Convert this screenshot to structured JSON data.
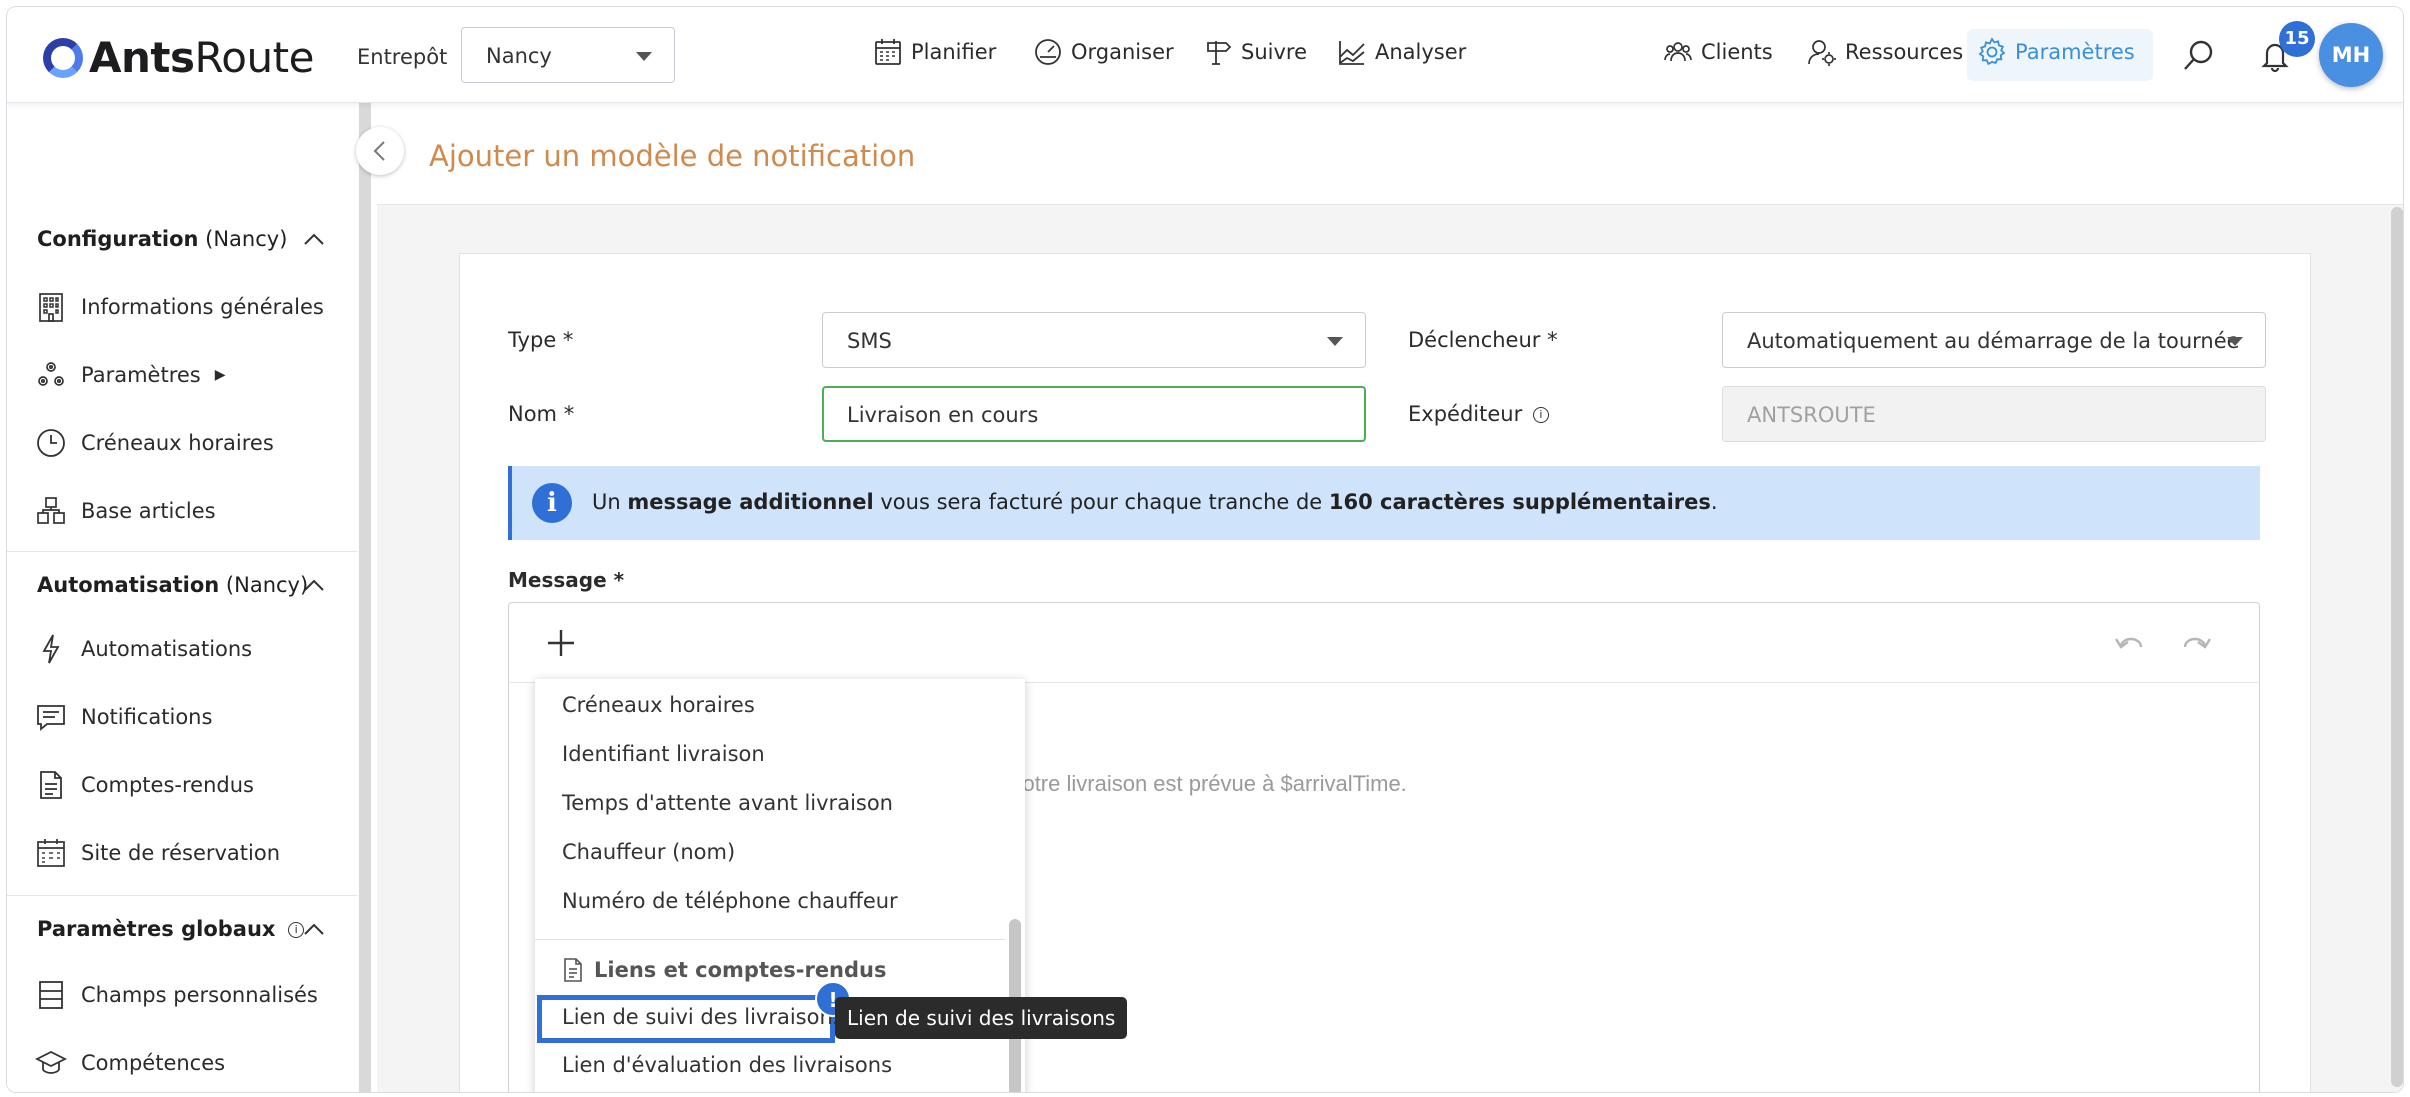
{
  "app": {
    "logo_bold": "Ants",
    "logo_light": "Route"
  },
  "header": {
    "entrepot_label": "Entrepôt",
    "entrepot_value": "Nancy",
    "nav": {
      "planifier": "Planifier",
      "organiser": "Organiser",
      "suivre": "Suivre",
      "analyser": "Analyser",
      "clients": "Clients",
      "ressources": "Ressources",
      "parametres": "Paramètres"
    },
    "notification_count": "15",
    "avatar_initials": "MH",
    "accent_color": "#3b8fd6"
  },
  "sidebar": {
    "sections": [
      {
        "title": "Configuration",
        "suffix": " (Nancy)"
      },
      {
        "title": "Automatisation",
        "suffix": " (Nancy)"
      },
      {
        "title": "Paramètres globaux",
        "suffix": ""
      }
    ],
    "items": {
      "informations_generales": "Informations générales",
      "parametres": "Paramètres",
      "creneaux_horaires": "Créneaux horaires",
      "base_articles": "Base articles",
      "automatisations": "Automatisations",
      "notifications": "Notifications",
      "comptes_rendus": "Comptes-rendus",
      "site_reservation": "Site de réservation",
      "champs_personnalises": "Champs personnalisés",
      "competences": "Compétences"
    }
  },
  "page": {
    "title": "Ajouter un modèle de notification",
    "form": {
      "type_label": "Type *",
      "type_value": "SMS",
      "declencheur_label": "Déclencheur *",
      "declencheur_value": "Automatiquement au démarrage de la tournée",
      "nom_label": "Nom *",
      "nom_value": "Livraison en cours",
      "expediteur_label": "Expéditeur",
      "expediteur_value": "ANTSROUTE"
    },
    "info": {
      "part1": "Un ",
      "bold1": "message additionnel",
      "part2": " vous sera facturé pour chaque tranche de ",
      "bold2": "160 caractères supplémentaires",
      "part3": "."
    },
    "message_label": "Message *",
    "message_placeholder": "Votre livraison est prévue à $arrivalTime.",
    "dropdown": {
      "items": [
        "Créneaux horaires",
        "Identifiant livraison",
        "Temps d'attente avant livraison",
        "Chauffeur (nom)",
        "Numéro de téléphone chauffeur"
      ],
      "group_title": "Liens et comptes-rendus",
      "group_items": [
        "Lien de suivi des livraisons",
        "Lien d'évaluation des livraisons"
      ],
      "tooltip": "Lien de suivi des livraisons",
      "excl": "!"
    }
  }
}
